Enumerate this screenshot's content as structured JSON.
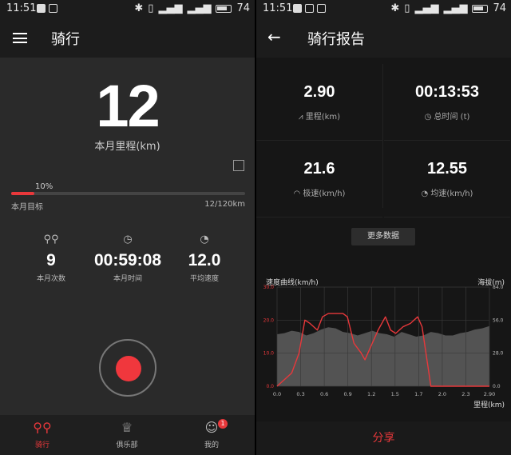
{
  "status_left": {
    "time": "11:51",
    "battery": "74"
  },
  "status_right": {
    "time": "11:51",
    "battery": "74"
  },
  "left": {
    "title": "骑行",
    "big_number": "12",
    "big_caption": "本月里程(km)",
    "progress": {
      "percent_label": "10%",
      "fraction": 0.1,
      "goal_label": "本月目标",
      "goal_value": "12/120km"
    },
    "stats": [
      {
        "icon": "bike-icon",
        "value": "9",
        "label": "本月次数"
      },
      {
        "icon": "clock-icon",
        "value": "00:59:08",
        "label": "本月时间"
      },
      {
        "icon": "stopwatch-icon",
        "value": "12.0",
        "label": "平均速度"
      }
    ],
    "tabs": [
      {
        "label": "骑行",
        "icon": "bike-icon",
        "active": true
      },
      {
        "label": "俱乐部",
        "icon": "trophy-icon",
        "active": false
      },
      {
        "label": "我的",
        "icon": "user-icon",
        "active": false,
        "badge": "1"
      }
    ]
  },
  "right": {
    "title": "骑行报告",
    "metrics": [
      {
        "value": "2.90",
        "label": "里程(km)",
        "icon": "road-icon"
      },
      {
        "value": "00:13:53",
        "label": "总时间 (t)",
        "icon": "clock-icon"
      },
      {
        "value": "21.6",
        "label": "极速(km/h)",
        "icon": "speedometer-icon"
      },
      {
        "value": "12.55",
        "label": "均速(km/h)",
        "icon": "stopwatch-icon"
      }
    ],
    "more_button": "更多数据",
    "share_button": "分享"
  },
  "chart_data": {
    "type": "line",
    "title": "",
    "ylabel": "速度曲线(km/h)",
    "y2label": "海拔(m)",
    "xlabel": "里程(km)",
    "x_ticks": [
      "0.0",
      "0.3",
      "0.6",
      "0.9",
      "1.2",
      "1.5",
      "1.7",
      "2.0",
      "2.3",
      "2.90"
    ],
    "y_ticks": [
      "0.0",
      "10.0",
      "20.0",
      "30.0"
    ],
    "y2_ticks": [
      "0.0",
      "28.0",
      "56.0",
      "84.0"
    ],
    "ylim": [
      0,
      30
    ],
    "y2lim": [
      0,
      84
    ],
    "grid": true,
    "speed_color": "#e8383b",
    "altitude_color": "#5a5a5a",
    "series": [
      {
        "name": "速度曲线(km/h)",
        "axis": "left",
        "x": [
          0,
          0.1,
          0.2,
          0.3,
          0.38,
          0.45,
          0.55,
          0.62,
          0.7,
          0.8,
          0.9,
          0.96,
          1.05,
          1.15,
          1.2,
          1.28,
          1.38,
          1.48,
          1.55,
          1.62,
          1.72,
          1.82,
          1.92,
          1.98,
          2.02,
          2.1,
          2.3,
          2.6,
          2.9
        ],
        "y": [
          0,
          2,
          4,
          10,
          20,
          19,
          17,
          21,
          22,
          22,
          22,
          21,
          13,
          10,
          8,
          12,
          17,
          21,
          17,
          16,
          18,
          19,
          21,
          18,
          12,
          0,
          0,
          0,
          0
        ]
      },
      {
        "name": "海拔(m)",
        "axis": "right",
        "x": [
          0,
          0.1,
          0.2,
          0.3,
          0.4,
          0.5,
          0.6,
          0.7,
          0.8,
          0.9,
          1.0,
          1.1,
          1.2,
          1.3,
          1.4,
          1.5,
          1.6,
          1.7,
          1.8,
          1.9,
          2.0,
          2.1,
          2.2,
          2.3,
          2.4,
          2.5,
          2.6,
          2.7,
          2.8,
          2.9
        ],
        "y": [
          44,
          45,
          47,
          46,
          43,
          45,
          48,
          50,
          49,
          46,
          45,
          43,
          45,
          47,
          45,
          44,
          42,
          46,
          44,
          42,
          43,
          46,
          45,
          43,
          43,
          45,
          46,
          48,
          49,
          51
        ]
      }
    ]
  }
}
